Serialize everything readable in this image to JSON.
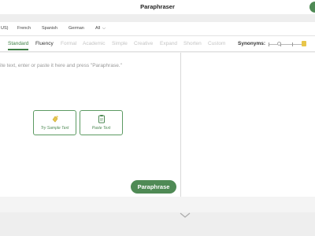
{
  "header": {
    "title": "Paraphraser"
  },
  "languages": {
    "tabs": [
      "US)",
      "French",
      "Spanish",
      "German",
      "All"
    ]
  },
  "modes": {
    "items": [
      "Standard",
      "Fluency",
      "Formal",
      "Academic",
      "Simple",
      "Creative",
      "Expand",
      "Shorten",
      "Custom"
    ],
    "active": "Standard",
    "synonyms_label": "Synonyms:",
    "synonyms_level": 1.0
  },
  "editor": {
    "placeholder": "ite text, enter or paste it here and press \"Paraphrase.\"",
    "sample_button": "Try Sample Text",
    "paste_button": "Paste Text",
    "paraphrase_button": "Paraphrase"
  },
  "colors": {
    "accent": "#4f8a55",
    "slider_knob": "#e8c64a"
  },
  "icons": {
    "sample": "sparkle-icon",
    "paste": "clipboard-icon",
    "collapse": "chevron-down-icon"
  }
}
